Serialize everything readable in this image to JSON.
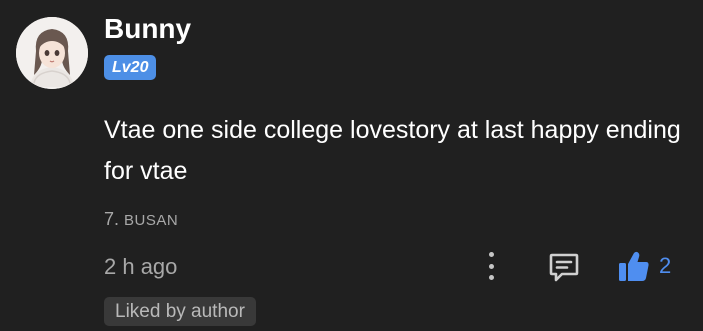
{
  "comment": {
    "username": "Bunny",
    "level_badge": "Lv20",
    "body": "Vtae one side college lovestory at last happy ending for vtae",
    "tag_number": "7.",
    "tag_name": "BUSAN",
    "timestamp": "2 h ago",
    "like_count": "2",
    "liked_by_author_label": "Liked by author"
  },
  "icons": {
    "avatar": "anime-girl-avatar",
    "more": "more-vertical-icon",
    "reply": "reply-comment-icon",
    "like": "thumbs-up-icon"
  },
  "colors": {
    "background": "#202020",
    "level_badge": "#4d8fe6",
    "like_active": "#4f8ef0",
    "muted_text": "#a8a8a8"
  }
}
